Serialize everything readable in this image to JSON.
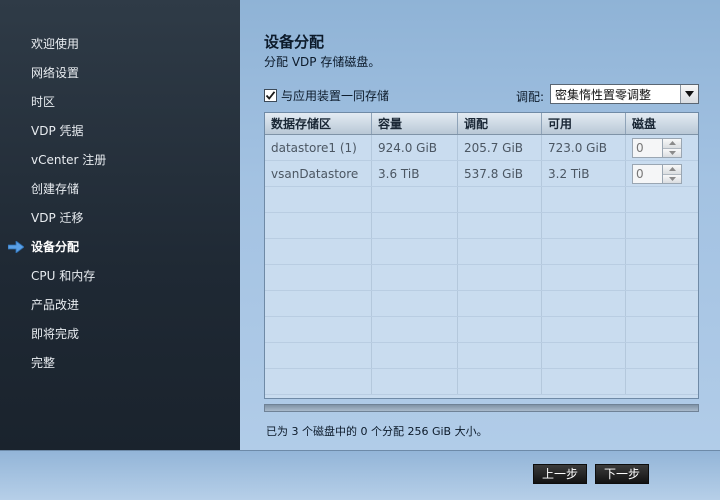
{
  "sidebar": {
    "items": [
      {
        "label": "欢迎使用",
        "active": false
      },
      {
        "label": "网络设置",
        "active": false
      },
      {
        "label": "时区",
        "active": false
      },
      {
        "label": "VDP 凭据",
        "active": false
      },
      {
        "label": "vCenter 注册",
        "active": false
      },
      {
        "label": "创建存储",
        "active": false
      },
      {
        "label": "VDP 迁移",
        "active": false
      },
      {
        "label": "设备分配",
        "active": true
      },
      {
        "label": "CPU 和内存",
        "active": false
      },
      {
        "label": "产品改进",
        "active": false
      },
      {
        "label": "即将完成",
        "active": false
      },
      {
        "label": "完整",
        "active": false
      }
    ],
    "active_icon": "right-arrow-icon",
    "active_icon_color": "#5aa0e6"
  },
  "main": {
    "title": "设备分配",
    "subtitle": "分配 VDP 存储磁盘。",
    "store_with_appliance": {
      "label": "与应用装置一同存储",
      "checked": true
    },
    "allocation": {
      "label": "调配:",
      "selected": "密集惰性置零调整"
    },
    "table": {
      "headers": [
        "数据存储区",
        "容量",
        "调配",
        "可用",
        "磁盘"
      ],
      "rows": [
        {
          "datastore": "datastore1 (1)",
          "capacity": "924.0 GiB",
          "provisioned": "205.7 GiB",
          "available": "723.0 GiB",
          "disks": "0"
        },
        {
          "datastore": "vsanDatastore",
          "capacity": "3.6 TiB",
          "provisioned": "537.8 GiB",
          "available": "3.2 TiB",
          "disks": "0"
        }
      ]
    },
    "summary": "已为 3 个磁盘中的 0 个分配 256 GiB 大小。"
  },
  "footer": {
    "prev_label": "上一步",
    "next_label": "下一步"
  }
}
